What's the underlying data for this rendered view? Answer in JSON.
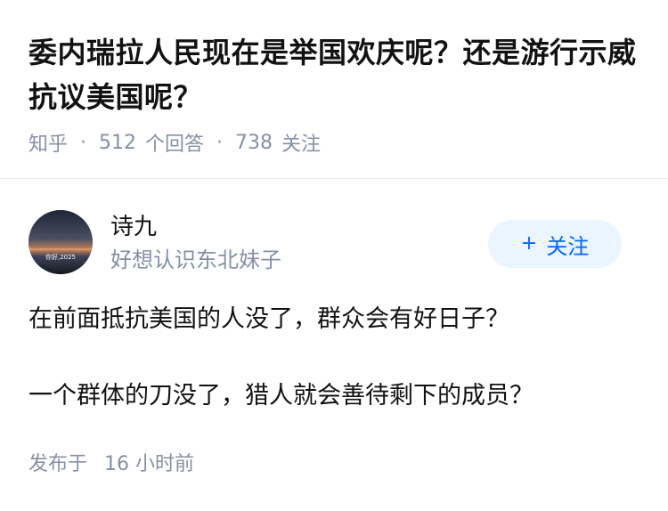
{
  "question": {
    "title": "委内瑞拉人民现在是举国欢庆呢？还是游行示威抗议美国呢？",
    "source": "知乎",
    "answer_count": "512",
    "answer_label": "个回答",
    "follower_count": "738",
    "follower_label": "关注"
  },
  "answer": {
    "author": {
      "name": "诗九",
      "bio": "好想认识东北妹子",
      "avatar_caption": "你好,2025"
    },
    "follow_button": {
      "icon": "+",
      "label": "关注"
    },
    "paragraphs": [
      "在前面抵抗美国的人没了，群众会有好日子？",
      "一个群体的刀没了，猎人就会善待剩下的成员？"
    ],
    "publish": {
      "prefix": "发布于",
      "time": "16 小时前"
    }
  },
  "colors": {
    "title": "#121212",
    "meta": "#8590a6",
    "accent": "#0066ff",
    "follow_bg": "#ebf5ff"
  }
}
